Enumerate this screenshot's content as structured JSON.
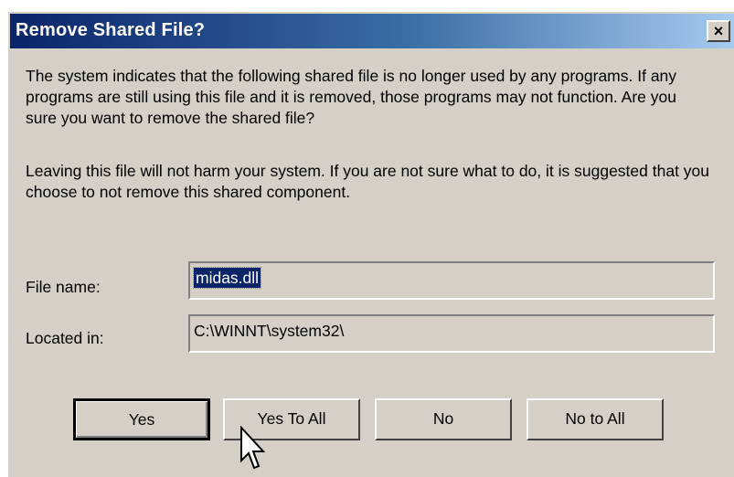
{
  "dialog": {
    "title": "Remove Shared File?",
    "close_label": "×"
  },
  "message": {
    "paragraph1": "The system indicates that the following shared file is no longer used by any programs.  If any programs are still using this file and it is removed, those programs may not function.  Are you sure you want to remove the shared file?",
    "paragraph2": "Leaving this file will not harm your system.  If you are not sure what to do, it is suggested that you choose to not remove this shared component."
  },
  "fields": {
    "file_name_label": "File name:",
    "file_name_value": "midas.dll",
    "located_in_label": "Located in:",
    "located_in_value": "C:\\WINNT\\system32\\"
  },
  "buttons": {
    "yes": "Yes",
    "yes_to_all": "Yes To All",
    "no": "No",
    "no_to_all": "No to All"
  },
  "colors": {
    "title_bar_start": "#0a246a",
    "title_bar_end": "#a6caf0",
    "dialog_face": "#d4d0c8",
    "selection": "#0a246a"
  },
  "icons": {
    "close": "close-icon",
    "cursor": "mouse-pointer-icon"
  }
}
